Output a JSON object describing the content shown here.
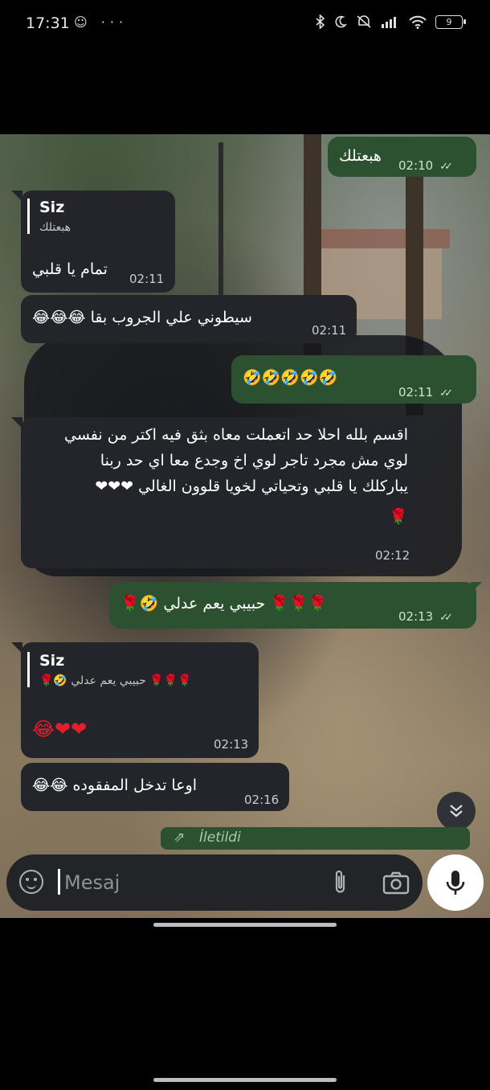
{
  "status_bar": {
    "time": "17:31",
    "left_icons": "☺ ···",
    "battery": "9"
  },
  "messages": [
    {
      "id": "m1",
      "direction": "out",
      "text": "هبعتلك",
      "time": "02:10",
      "ticks": "✓✓"
    },
    {
      "id": "m2",
      "direction": "in",
      "reply_name": "Siz",
      "reply_text": "هبعتلك",
      "text": "تمام يا قلبي",
      "time": "02:11"
    },
    {
      "id": "m3",
      "direction": "in",
      "text": "سيطوني علي الجروب بقا 😂😂😂",
      "time": "02:11"
    },
    {
      "id": "m4",
      "direction": "out",
      "text": "🤣🤣🤣🤣🤣",
      "time": "02:11",
      "ticks": "✓✓"
    },
    {
      "id": "m5",
      "direction": "in",
      "lines": [
        "اقسم بلله احلا حد اتعملت معاه بثق فيه اكتر من نفسي",
        "لوي مش مجرد تاجر لوي اخ وجدع معا اي حد ربنا",
        "يباركلك يا قلبي وتحياتي لخويا قلوون الغالي ❤❤❤",
        "🌹"
      ],
      "time": "02:12"
    },
    {
      "id": "m6",
      "direction": "out",
      "text": "🌹🌹🌹 حبيبي يعم عدلي 🤣🌹",
      "time": "02:13",
      "ticks": "✓✓"
    },
    {
      "id": "m7",
      "direction": "in",
      "reply_name": "Siz",
      "reply_text": "🌹🌹🌹 حبيبي يعم عدلي 🤣🌹",
      "text": "❤❤😂",
      "time": "02:13"
    },
    {
      "id": "m8",
      "direction": "in",
      "text": "اوعا تدخل المفقوده 😂😂",
      "time": "02:16"
    }
  ],
  "forward_bar": {
    "icon": "⇗",
    "label": "İletildi"
  },
  "input": {
    "placeholder": "Mesaj"
  },
  "icons": {
    "emoji": "emoji-icon",
    "attach": "paperclip-icon",
    "camera": "camera-icon",
    "mic": "microphone-icon",
    "scroll": "chevron-double-down-icon"
  }
}
